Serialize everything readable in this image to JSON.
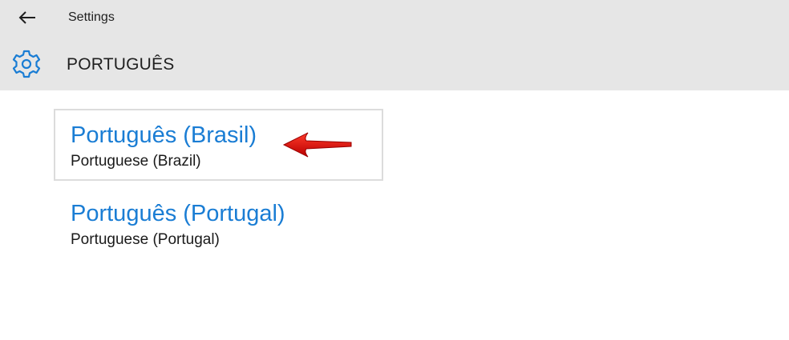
{
  "header": {
    "app_title": "Settings",
    "page_title": "PORTUGUÊS",
    "back_icon": "back-arrow-icon",
    "settings_icon": "gear-icon"
  },
  "languages": [
    {
      "native": "Português (Brasil)",
      "english": "Portuguese (Brazil)",
      "selected": true
    },
    {
      "native": "Português (Portugal)",
      "english": "Portuguese (Portugal)",
      "selected": false
    }
  ],
  "annotation": {
    "icon": "red-arrow-pointer-icon",
    "color": "#d40000"
  },
  "colors": {
    "accent": "#1a7dd4",
    "header_bg": "#e6e6e6"
  }
}
